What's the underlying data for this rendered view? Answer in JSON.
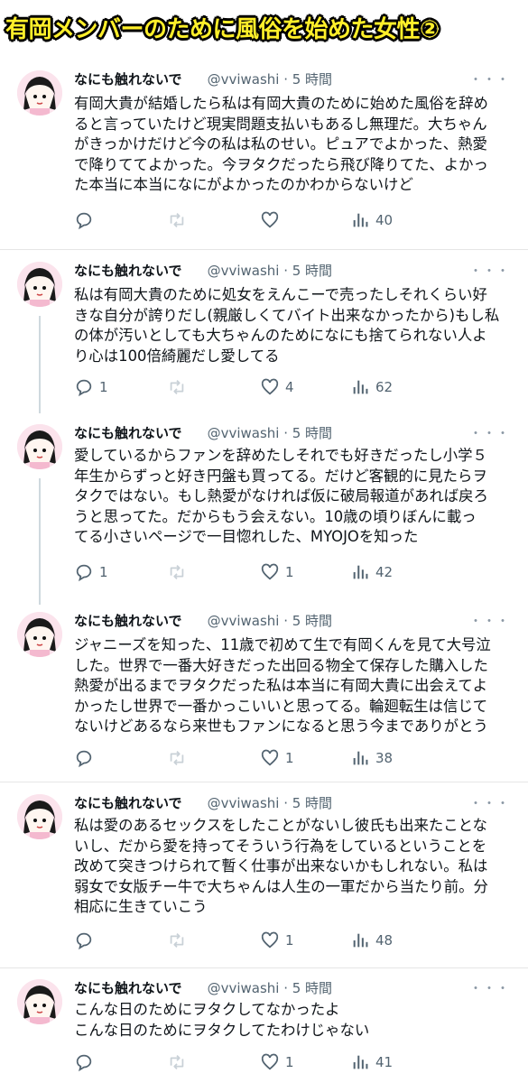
{
  "banner": {
    "title": "有岡メンバーのために風俗を始めた女性②"
  },
  "more_glyph": "・・・",
  "tweets": [
    {
      "name": "なにも触れないで",
      "handle": "@vviwashi · 5 時間",
      "lines": [
        "有岡大貴が結婚したら私は有岡大貴のために始めた風俗を辞め",
        "ると言っていたけど現実問題支払いもあるし無理だ。大ちゃん",
        "がきっかけだけど今の私は私のせい。ピュアでよかった、熱愛",
        "で降りててよかった。今ヲタクだったら飛び降りてた、よかっ",
        "た本当に本当になにがよかったのかわからないけど"
      ],
      "replies": "",
      "retweets": "",
      "likes": "",
      "views": "40"
    },
    {
      "name": "なにも触れないで",
      "handle": "@vviwashi · 5 時間",
      "lines": [
        "私は有岡大貴のために処女をえんこーで売ったしそれくらい好",
        "きな自分が誇りだし(親厳しくてバイト出来なかったから)もし私",
        "の体が汚いとしても大ちゃんのためになにも捨てられない人よ",
        "り心は100倍綺麗だし愛してる"
      ],
      "replies": "1",
      "retweets": "",
      "likes": "4",
      "views": "62"
    },
    {
      "name": "なにも触れないで",
      "handle": "@vviwashi · 5 時間",
      "lines": [
        "愛しているからファンを辞めたしそれでも好きだったし小学５",
        "年生からずっと好き円盤も買ってる。だけど客観的に見たらヲ",
        "タクではない。もし熱愛がなければ仮に破局報道があれば戻ろ",
        "うと思ってた。だからもう会えない。10歳の頃りぼんに載っ",
        "てる小さいページで一目惚れした、MYOJOを知った"
      ],
      "replies": "1",
      "retweets": "",
      "likes": "1",
      "views": "42"
    },
    {
      "name": "なにも触れないで",
      "handle": "@vviwashi · 5 時間",
      "lines": [
        "ジャニーズを知った、11歳で初めて生で有岡くんを見て大号泣",
        "した。世界で一番大好きだった出回る物全て保存した購入した",
        "熱愛が出るまでヲタクだった私は本当に有岡大貴に出会えてよ",
        "かったし世界で一番かっこいいと思ってる。輪廻転生は信じて",
        "ないけどあるなら来世もファンになると思う今までありがとう"
      ],
      "replies": "",
      "retweets": "",
      "likes": "1",
      "views": "38"
    },
    {
      "name": "なにも触れないで",
      "handle": "@vviwashi · 5 時間",
      "lines": [
        "私は愛のあるセックスをしたことがないし彼氏も出来たことな",
        "いし、だから愛を持ってそういう行為をしているということを",
        "改めて突きつけられて暫く仕事が出来ないかもしれない。私は",
        "弱女で女版チー牛で大ちゃんは人生の一軍だから当たり前。分",
        "相応に生きていこう"
      ],
      "replies": "",
      "retweets": "",
      "likes": "1",
      "views": "48"
    },
    {
      "name": "なにも触れないで",
      "handle": "@vviwashi · 5 時間",
      "lines": [
        "こんな日のためにヲタクしてなかったよ",
        "こんな日のためにヲタクしてたわけじゃない"
      ],
      "replies": "",
      "retweets": "",
      "likes": "1",
      "views": "41"
    }
  ],
  "colors": {
    "banner_fill": "#ffef2a",
    "banner_outline": "#000000",
    "meta_gray": "#536471"
  },
  "icons": {
    "reply": "reply-icon",
    "retweet": "retweet-icon",
    "like": "heart-icon",
    "views": "views-icon",
    "more": "more-icon"
  }
}
